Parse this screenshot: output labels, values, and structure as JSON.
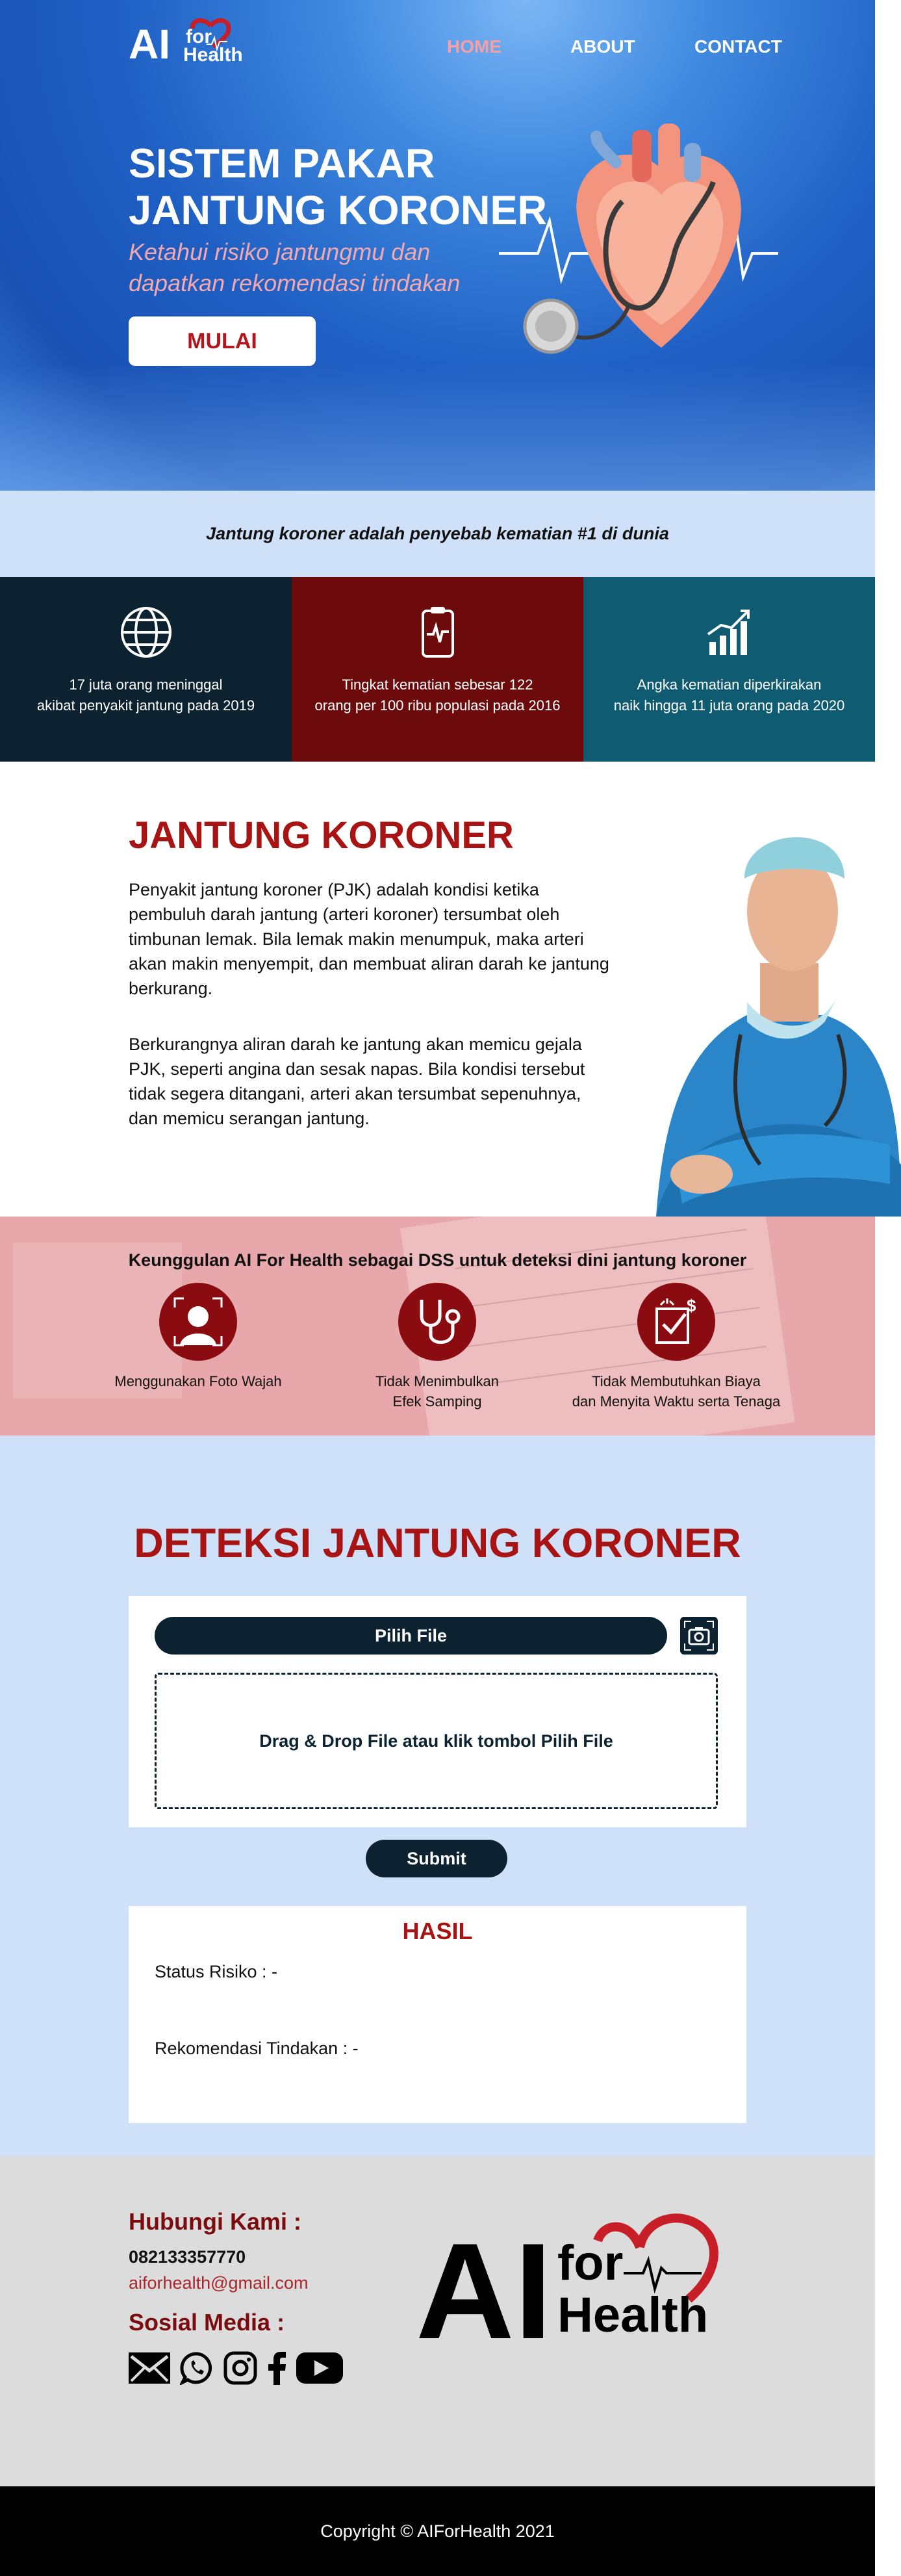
{
  "nav": {
    "home": "HOME",
    "about": "ABOUT",
    "contact": "CONTACT"
  },
  "logo": {
    "ai": "AI",
    "for": "for",
    "health": "Health"
  },
  "hero": {
    "title_line1": "SISTEM PAKAR",
    "title_line2": "JANTUNG KORONER",
    "subtitle_line1": "Ketahui risiko jantungmu dan",
    "subtitle_line2": "dapatkan rekomendasi tindakan",
    "button": "MULAI"
  },
  "fact_band": "Jantung koroner adalah penyebab kematian #1 di dunia",
  "stats": [
    {
      "icon": "globe-icon",
      "line1": "17 juta orang meninggal",
      "line2": "akibat penyakit jantung pada 2019"
    },
    {
      "icon": "heart-monitor-icon",
      "line1": "Tingkat kematian sebesar 122",
      "line2": "orang per 100 ribu populasi pada 2016"
    },
    {
      "icon": "growth-chart-icon",
      "line1": "Angka kematian diperkirakan",
      "line2": "naik hingga 11 juta orang pada 2020"
    }
  ],
  "about": {
    "title": "JANTUNG KORONER",
    "p1": "Penyakit jantung koroner (PJK) adalah kondisi ketika pembuluh darah jantung (arteri koroner) tersumbat oleh timbunan lemak. Bila lemak makin menumpuk, maka arteri akan makin menyempit, dan membuat aliran darah ke jantung berkurang.",
    "p2": "Berkurangnya aliran darah ke jantung akan memicu gejala PJK, seperti angina dan sesak napas. Bila kondisi tersebut tidak segera ditangani, arteri akan tersumbat sepenuhnya, dan memicu serangan jantung."
  },
  "advantages": {
    "title": "Keunggulan AI For Health sebagai DSS untuk deteksi dini jantung koroner",
    "items": [
      {
        "icon": "face-scan-icon",
        "line1": "Menggunakan Foto Wajah",
        "line2": ""
      },
      {
        "icon": "stethoscope-icon",
        "line1": "Tidak Menimbulkan",
        "line2": "Efek Samping"
      },
      {
        "icon": "money-check-icon",
        "line1": "Tidak Membutuhkan Biaya",
        "line2": "dan Menyita Waktu serta Tenaga"
      }
    ]
  },
  "detection": {
    "title": "DETEKSI JANTUNG KORONER",
    "choose_file": "Pilih File",
    "dropzone": "Drag & Drop File atau klik tombol Pilih File",
    "submit": "Submit",
    "result_title": "HASIL",
    "status": "Status Risiko : -",
    "recommendation": "Rekomendasi Tindakan : -"
  },
  "contact": {
    "heading": "Hubungi Kami :",
    "phone": "082133357770",
    "email": "aiforhealth@gmail.com",
    "social_heading": "Sosial Media :",
    "social_icons": [
      "email-icon",
      "whatsapp-icon",
      "instagram-icon",
      "facebook-icon",
      "youtube-icon"
    ]
  },
  "footer": "Copyright © AIForHealth 2021",
  "colors": {
    "brand_red": "#a81313",
    "navy": "#0c2231",
    "teal": "#0f5b71",
    "maroon": "#6d0b0c",
    "light_blue": "#cfe1f8",
    "pink": "#e7a7ab"
  }
}
